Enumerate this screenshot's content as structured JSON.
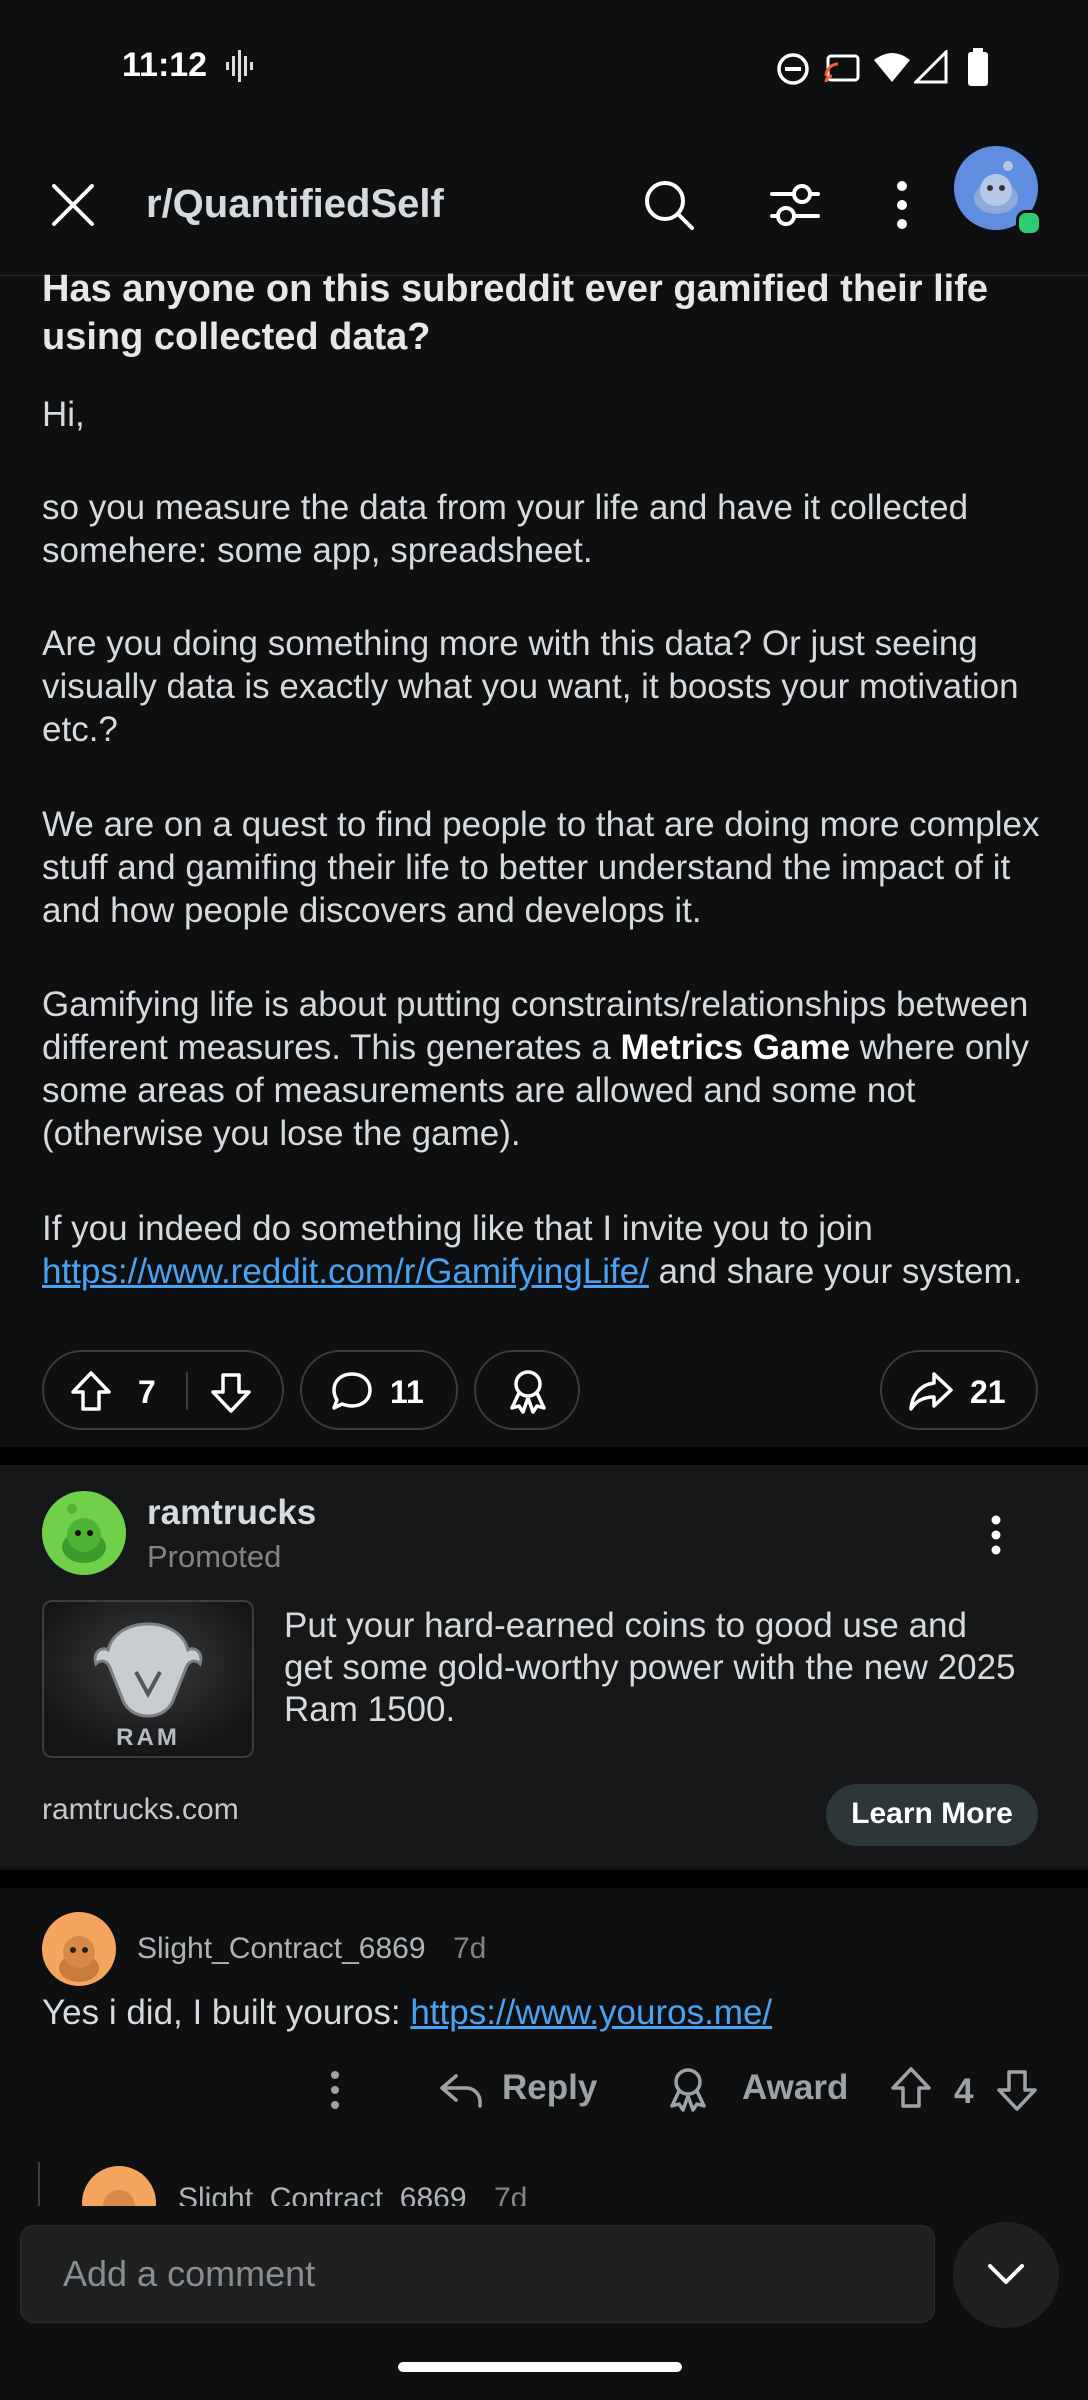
{
  "status_bar": {
    "time": "11:12"
  },
  "header": {
    "subreddit": "r/QuantifiedSelf"
  },
  "post": {
    "title": "Has anyone on this subreddit ever gamified their life using collected data?",
    "greeting": "Hi,",
    "p1": "so you measure the data from your life and have it collected somehere: some app, spreadsheet.",
    "p2": "Are you doing something more with this data? Or just seeing visually data is exactly what you want, it boosts your motivation etc.?",
    "p3": "We are on a quest to find people to that are doing more complex stuff and gamifing their life to better understand the impact of it and how people discovers and develops it.",
    "p4_before": "Gamifying life is about putting constraints/relationships between different measures. This generates a ",
    "p4_bold": "Metrics Game",
    "p4_after": " where only some areas of measurements are allowed and some not (otherwise you lose the game).",
    "p5_before": "If you indeed do something like that I invite you to join ",
    "p5_link": "https://www.reddit.com/r/GamifyingLife/",
    "p5_after": " and share your system.",
    "votes": "7",
    "comments": "11",
    "shares": "21"
  },
  "ad": {
    "advertiser": "ramtrucks",
    "promoted_label": "Promoted",
    "logo_text": "RAM",
    "body": "Put your hard-earned coins to good use and get some gold-worthy power with the new 2025 Ram 1500.",
    "domain": "ramtrucks.com",
    "cta": "Learn More"
  },
  "comment": {
    "author": "Slight_Contract_6869",
    "age": "7d",
    "text_before": "Yes i did, I built youros: ",
    "link": "https://www.youros.me/",
    "reply_label": "Reply",
    "award_label": "Award",
    "score": "4"
  },
  "reply_preview": {
    "author": "Slight_Contract_6869",
    "age": "7d"
  },
  "composer": {
    "placeholder": "Add a comment"
  },
  "colors": {
    "accent_link": "#4aa3f2",
    "online": "#2ecc71",
    "background": "#0e0f10"
  }
}
